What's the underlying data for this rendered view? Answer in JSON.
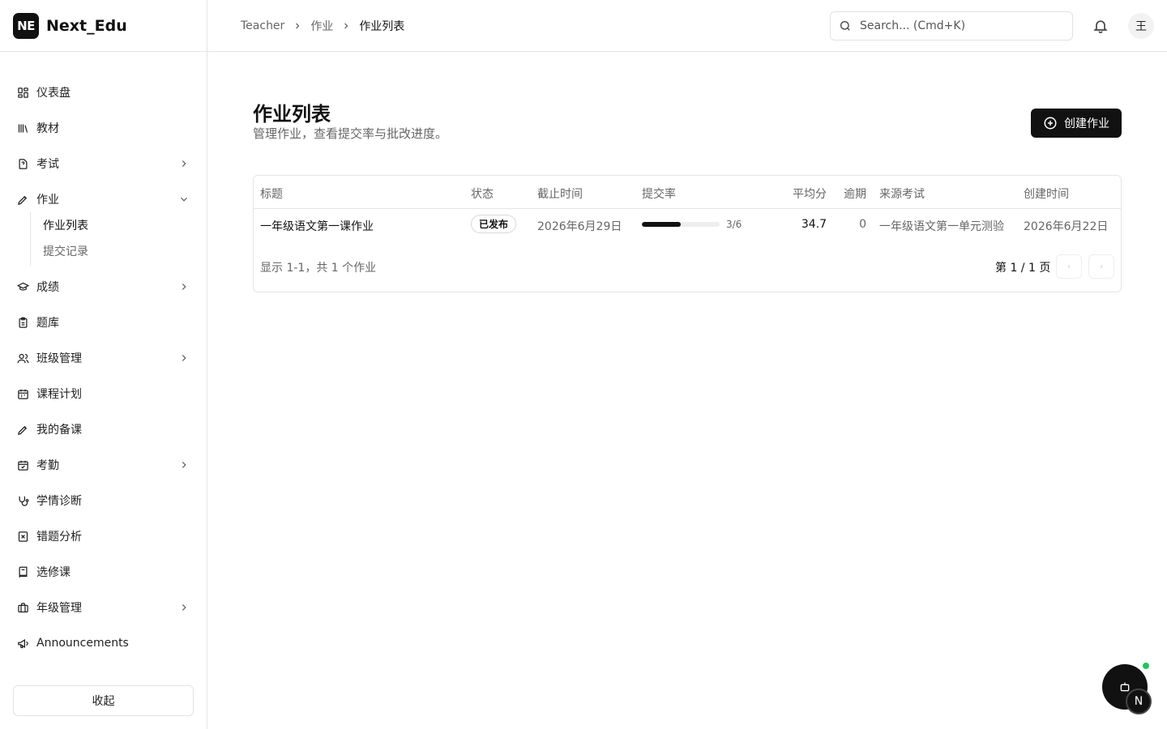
{
  "brand": {
    "logo_text": "NE",
    "name": "Next_Edu"
  },
  "sidebar": {
    "items": [
      {
        "label": "仪表盘",
        "icon": "dashboard-icon"
      },
      {
        "label": "教材",
        "icon": "library-icon"
      },
      {
        "label": "考试",
        "icon": "exam-icon",
        "expandable": true
      },
      {
        "label": "作业",
        "icon": "pen-icon",
        "expandable": true,
        "expanded": true,
        "children": [
          {
            "label": "作业列表",
            "active": true
          },
          {
            "label": "提交记录"
          }
        ]
      },
      {
        "label": "成绩",
        "icon": "graduation-cap-icon",
        "expandable": true
      },
      {
        "label": "题库",
        "icon": "clipboard-icon"
      },
      {
        "label": "班级管理",
        "icon": "users-icon",
        "expandable": true
      },
      {
        "label": "课程计划",
        "icon": "calendar-icon"
      },
      {
        "label": "我的备课",
        "icon": "pen-icon"
      },
      {
        "label": "考勤",
        "icon": "calendar-check-icon",
        "expandable": true
      },
      {
        "label": "学情诊断",
        "icon": "stethoscope-icon"
      },
      {
        "label": "错题分析",
        "icon": "x-square-icon"
      },
      {
        "label": "选修课",
        "icon": "book-icon"
      },
      {
        "label": "年级管理",
        "icon": "briefcase-icon",
        "expandable": true
      },
      {
        "label": "Announcements",
        "icon": "megaphone-icon"
      }
    ],
    "collapse_label": "收起"
  },
  "header": {
    "breadcrumb": [
      "Teacher",
      "作业",
      "作业列表"
    ],
    "search_placeholder": "Search... (Cmd+K)",
    "avatar_text": "王"
  },
  "main": {
    "title": "作业列表",
    "subtitle": "管理作业，查看提交率与批改进度。",
    "create_button": "创建作业",
    "table": {
      "columns": [
        "标题",
        "状态",
        "截止时间",
        "提交率",
        "平均分",
        "逾期",
        "来源考试",
        "创建时间"
      ],
      "rows": [
        {
          "title": "一年级语文第一课作业",
          "status": "已发布",
          "due": "2026年6月29日",
          "submitted_ratio": 0.5,
          "submitted_text": "3/6",
          "avg_score": "34.7",
          "overdue": "0",
          "source_exam": "一年级语文第一单元测验",
          "created": "2026年6月22日"
        }
      ],
      "footer_info": "显示 1-1，共 1 个作业",
      "page_info": "第 1 / 1 页"
    }
  },
  "floating": {
    "badge_text": "N",
    "status_color": "#22c55e"
  }
}
